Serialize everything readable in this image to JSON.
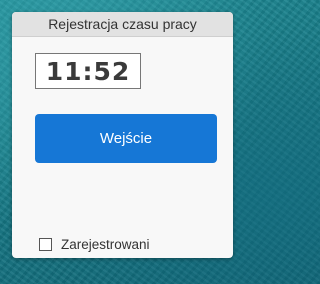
{
  "panel": {
    "title": "Rejestracja czasu pracy",
    "clock": "11:52",
    "enter_button_label": "Wejście",
    "registered_checkbox": {
      "label": "Zarejestrowani",
      "checked": false
    }
  },
  "colors": {
    "button": "#1677d6",
    "background": "#167985"
  }
}
